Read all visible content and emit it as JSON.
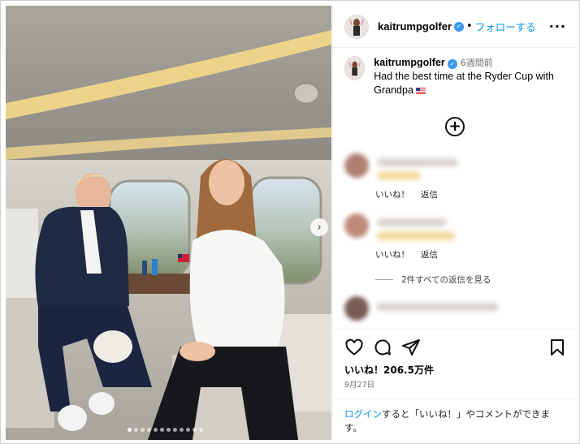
{
  "post": {
    "username": "kaitrumpgolfer",
    "follow_label": "フォローする",
    "more_icon": "more-horizontal-icon",
    "verified": true
  },
  "caption": {
    "username": "kaitrumpgolfer",
    "time": "6週間前",
    "text": "Had the best time at the Ryder Cup with Grandpa",
    "emoji": "us-flag"
  },
  "comments": [
    {
      "like_label": "いいね！",
      "reply_label": "返信",
      "avatar_color": "#b08070"
    },
    {
      "like_label": "いいね！",
      "reply_label": "返信",
      "avatar_color": "#c08a78"
    },
    {
      "like_label": "",
      "reply_label": "",
      "avatar_color": "#7a5a55"
    }
  ],
  "replies_link": "2件すべての返信を見る",
  "likes": "いいね！206.5万件",
  "date": "9月27日",
  "login": {
    "link": "ログイン",
    "text": "すると「いいね！」やコメントができます。"
  },
  "carousel": {
    "dot_count": 12,
    "active_index": 0
  },
  "colors": {
    "accent": "#0095f6",
    "verified": "#3897f0"
  }
}
